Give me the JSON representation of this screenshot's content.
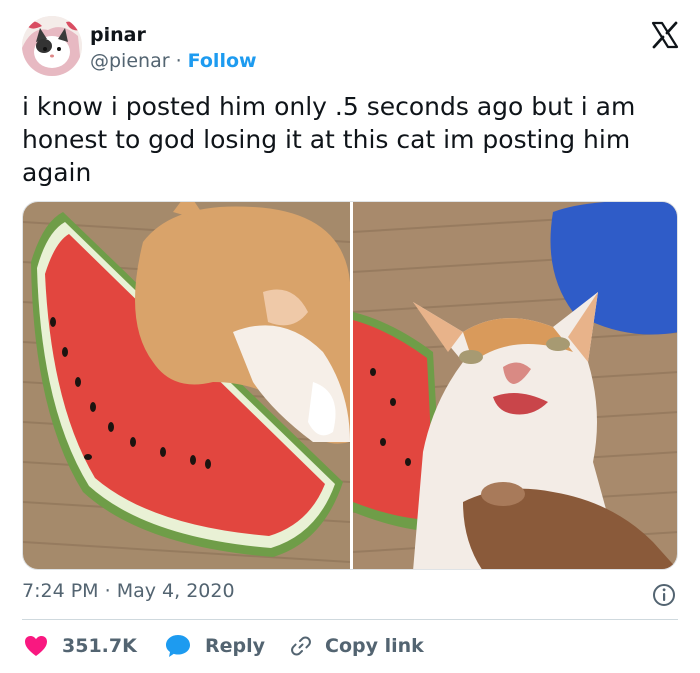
{
  "author": {
    "name": "pinar",
    "handle": "@pienar",
    "separator": "·",
    "follow_label": "Follow"
  },
  "tweet": {
    "text": "i know i posted him only .5 seconds ago but i am honest to god losing it at this cat im posting him again",
    "time": "7:24 PM",
    "date_separator": "·",
    "date": "May 4, 2020"
  },
  "media": [
    {
      "description": "orange and white kitten biting a watermelon slice on a woven mat"
    },
    {
      "description": "orange and white kitten with watermelon juice on its face, chin held by a hand"
    }
  ],
  "actions": {
    "like_count": "351.7K",
    "reply_label": "Reply",
    "copy_label": "Copy link"
  },
  "colors": {
    "accent": "#1d9bf0",
    "like": "#f91880",
    "muted": "#536471",
    "text": "#0f1419"
  },
  "icons": {
    "brand": "x-logo-icon",
    "like": "heart-icon",
    "reply": "speech-bubble-icon",
    "copy": "link-icon",
    "info": "info-icon"
  }
}
